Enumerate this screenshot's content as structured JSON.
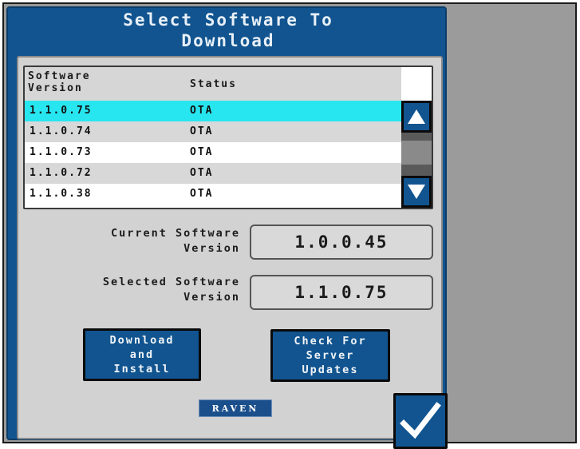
{
  "dialog": {
    "title": "Select Software To\nDownload"
  },
  "table": {
    "headers": {
      "version": "Software\nVersion",
      "status": "Status"
    },
    "rows": [
      {
        "version": "1.1.0.75",
        "status": "OTA",
        "selected": true
      },
      {
        "version": "1.1.0.74",
        "status": "OTA",
        "selected": false
      },
      {
        "version": "1.1.0.73",
        "status": "OTA",
        "selected": false
      },
      {
        "version": "1.1.0.72",
        "status": "OTA",
        "selected": false
      },
      {
        "version": "1.1.0.38",
        "status": "OTA",
        "selected": false
      }
    ],
    "scroll_up_icon": "triangle-up-icon",
    "scroll_down_icon": "triangle-down-icon"
  },
  "fields": {
    "current_label": "Current Software\nVersion",
    "current_value": "1.0.0.45",
    "selected_label": "Selected Software\nVersion",
    "selected_value": "1.1.0.75"
  },
  "buttons": {
    "download_install": "Download\nand\nInstall",
    "check_updates": "Check For\nServer\nUpdates",
    "confirm_icon": "checkmark-icon"
  },
  "logo": {
    "text": "RAVEN"
  },
  "colors": {
    "dialog_blue": "#11548f",
    "selected_row": "#28e6f0",
    "panel_grey": "#d2d2d2"
  }
}
